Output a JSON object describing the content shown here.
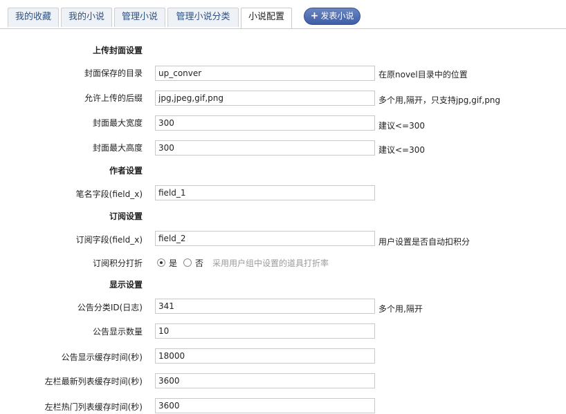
{
  "tabs": [
    {
      "label": "我的收藏",
      "active": false
    },
    {
      "label": "我的小说",
      "active": false
    },
    {
      "label": "管理小说",
      "active": false
    },
    {
      "label": "管理小说分类",
      "active": false
    },
    {
      "label": "小说配置",
      "active": true
    }
  ],
  "post_button": {
    "icon": "plus-icon",
    "label": "发表小说"
  },
  "sections": {
    "cover": "上传封面设置",
    "author": "作者设置",
    "subscribe": "订阅设置",
    "display": "显示设置"
  },
  "fields": {
    "cover_dir": {
      "label": "封面保存的目录",
      "value": "up_conver",
      "hint": "在原novel目录中的位置"
    },
    "allowed_ext": {
      "label": "允许上传的后缀",
      "value": "jpg,jpeg,gif,png",
      "hint": "多个用,隔开，只支持jpg,gif,png"
    },
    "cover_max_width": {
      "label": "封面最大宽度",
      "value": "300",
      "hint": "建议<=300"
    },
    "cover_max_height": {
      "label": "封面最大高度",
      "value": "300",
      "hint": "建议<=300"
    },
    "pen_name_field": {
      "label": "笔名字段(field_x)",
      "value": "field_1"
    },
    "subscribe_field": {
      "label": "订阅字段(field_x)",
      "value": "field_2",
      "hint": "用户设置是否自动扣积分"
    },
    "announce_cat_id": {
      "label": "公告分类ID(日志)",
      "value": "341",
      "hint": "多个用,隔开"
    },
    "announce_count": {
      "label": "公告显示数量",
      "value": "10"
    },
    "announce_cache": {
      "label": "公告显示缓存时间(秒)",
      "value": "18000"
    },
    "latest_cache": {
      "label": "左栏最新列表缓存时间(秒)",
      "value": "3600"
    },
    "hot_cache": {
      "label": "左栏热门列表缓存时间(秒)",
      "value": "3600"
    }
  },
  "discount": {
    "label": "订阅积分打折",
    "yes": "是",
    "no": "否",
    "selected": "yes",
    "note": "采用用户组中设置的道具打折率"
  }
}
